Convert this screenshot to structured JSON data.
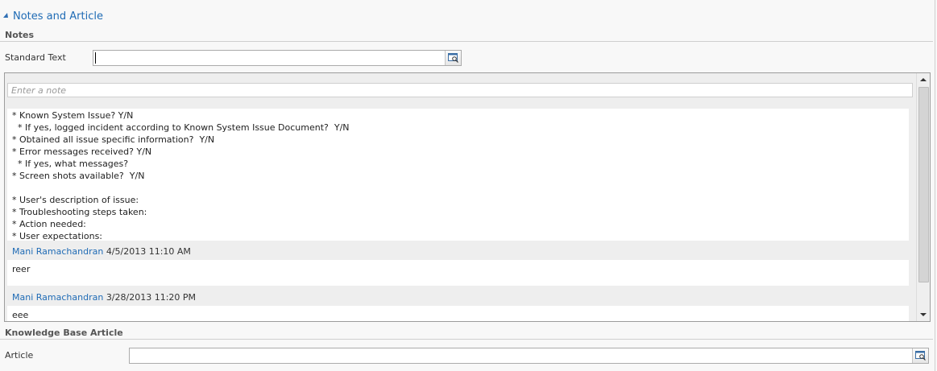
{
  "section": {
    "title": "Notes and Article"
  },
  "notes": {
    "header": "Notes",
    "standard_text_label": "Standard Text",
    "standard_text_value": "",
    "note_placeholder": "Enter a note",
    "template_text": "* Known System Issue? Y/N\n  * If yes, logged incident according to Known System Issue Document?  Y/N\n* Obtained all issue specific information?  Y/N\n* Error messages received? Y/N\n  * If yes, what messages?\n* Screen shots available?  Y/N\n\n* User's description of issue:\n* Troubleshooting steps taken:\n* Action needed:\n* User expectations:",
    "entries": [
      {
        "author": "Mani Ramachandran",
        "timestamp": "4/5/2013 11:10 AM",
        "text": "reer"
      },
      {
        "author": "Mani Ramachandran",
        "timestamp": "3/28/2013 11:20 PM",
        "text": "eee"
      }
    ]
  },
  "kb": {
    "header": "Knowledge Base Article",
    "article_label": "Article",
    "article_value": ""
  },
  "colors": {
    "accent": "#1f6bb5",
    "panel": "#eeeeee",
    "border": "#9c9c9c"
  },
  "icons": {
    "lookup": "lookup-icon",
    "collapse": "collapse-triangle-icon"
  }
}
